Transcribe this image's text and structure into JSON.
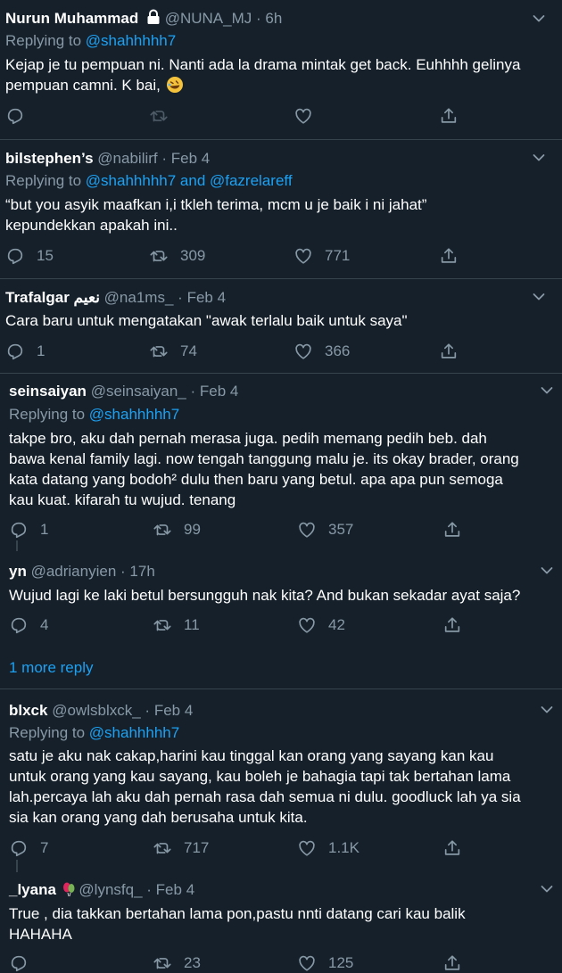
{
  "tweets": [
    {
      "name": "Nurun Muhammad",
      "handle": "@NUNA_MJ",
      "time": "6h",
      "replying": "Replying to",
      "mention": "@shahhhhh7",
      "text1": "Kejap je tu pempuan ni. Nanti ada la drama mintak get back. Euhhhh gelinya",
      "text2": "pempuan camni. K bai,",
      "emoji_icon": "rolling-on-floor-laughing-emoji",
      "replies": "",
      "retweets": "",
      "likes": ""
    },
    {
      "name": "bilstephen’s",
      "handle": "@nabilirf",
      "time": "Feb 4",
      "replying": "Replying to",
      "mention": "@shahhhhh7 and @fazrelareff",
      "text1": "“but you asyik maafkan i,i tkleh terima, mcm u je baik i ni jahat”",
      "text2": "kepundekkan apakah ini..",
      "replies": "15",
      "retweets": "309",
      "likes": "771"
    },
    {
      "name": "Trafalgar نعيم",
      "handle": "@na1ms_",
      "time": "Feb 4",
      "text1": "Cara baru untuk mengatakan \"awak terlalu baik untuk saya\"",
      "replies": "1",
      "retweets": "74",
      "likes": "366"
    },
    {
      "name": "seinsaiyan",
      "handle": "@seinsaiyan_",
      "time": "Feb 4",
      "replying": "Replying to",
      "mention": "@shahhhhh7",
      "text1": "takpe bro, aku dah pernah merasa juga. pedih memang pedih beb. dah",
      "text2": "bawa kenal family lagi. now tengah tanggung malu je. its okay brader, orang",
      "text3": "kata datang yang bodoh² dulu then baru yang betul. apa apa pun semoga",
      "text4": "kau kuat. kifarah tu wujud. tenang",
      "replies": "1",
      "retweets": "99",
      "likes": "357"
    },
    {
      "name": "yn",
      "handle": "@adrianyien",
      "time": "17h",
      "text1": "Wujud lagi ke laki betul bersungguh nak kita? And bukan sekadar ayat saja?",
      "replies": "4",
      "retweets": "11",
      "likes": "42"
    },
    {
      "name": "blxck",
      "handle": "@owlsblxck_",
      "time": "Feb 4",
      "replying": "Replying to",
      "mention": "@shahhhhh7",
      "text1": "satu je aku nak cakap,harini kau tinggal kan orang yang sayang kan kau",
      "text2": "untuk orang yang kau sayang, kau boleh je bahagia tapi tak bertahan lama",
      "text3": "lah.percaya lah aku dah pernah rasa dah semua ni dulu. goodluck lah ya sia",
      "text4": "sia kan orang yang dah berusaha untuk kita.",
      "replies": "7",
      "retweets": "717",
      "likes": "1.1K"
    },
    {
      "name": "_lyana",
      "handle": "@lynsfq_",
      "time": "Feb 4",
      "text1": "True , dia takkan bertahan lama pon,pastu nnti datang cari kau balik",
      "text2": "HAHAHA",
      "replies": "",
      "retweets": "23",
      "likes": "125"
    }
  ],
  "more_replies": "1 more reply",
  "separator": "·",
  "colors": {
    "background": "#15202b",
    "muted": "#8899a6",
    "link": "#1da1f2",
    "divider": "#38444d"
  }
}
